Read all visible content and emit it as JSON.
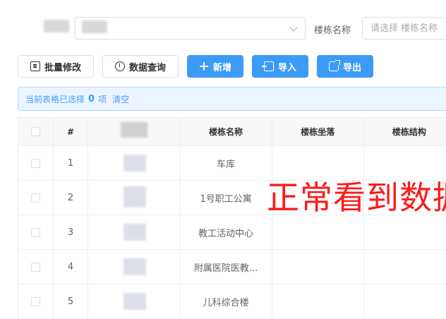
{
  "filter": {
    "building_label": "楼栋名称",
    "building_placeholder": "请选择 楼栋名称"
  },
  "toolbar": {
    "batch_edit": "批量修改",
    "data_query": "数据查询",
    "add": "新增",
    "import": "导入",
    "export": "导出"
  },
  "selection": {
    "prefix": "当前表格已选择",
    "count": "0",
    "suffix": "项",
    "clear": "清空"
  },
  "table": {
    "headers": [
      "#",
      "",
      "楼栋名称",
      "楼栋坐落",
      "楼栋结构"
    ],
    "rows": [
      {
        "index": "1",
        "name": "车库"
      },
      {
        "index": "2",
        "name": "1号职工公寓"
      },
      {
        "index": "3",
        "name": "教工活动中心"
      },
      {
        "index": "4",
        "name": "附属医院医教..."
      },
      {
        "index": "5",
        "name": "儿科综合楼"
      }
    ]
  },
  "annotation": "正常看到数据"
}
